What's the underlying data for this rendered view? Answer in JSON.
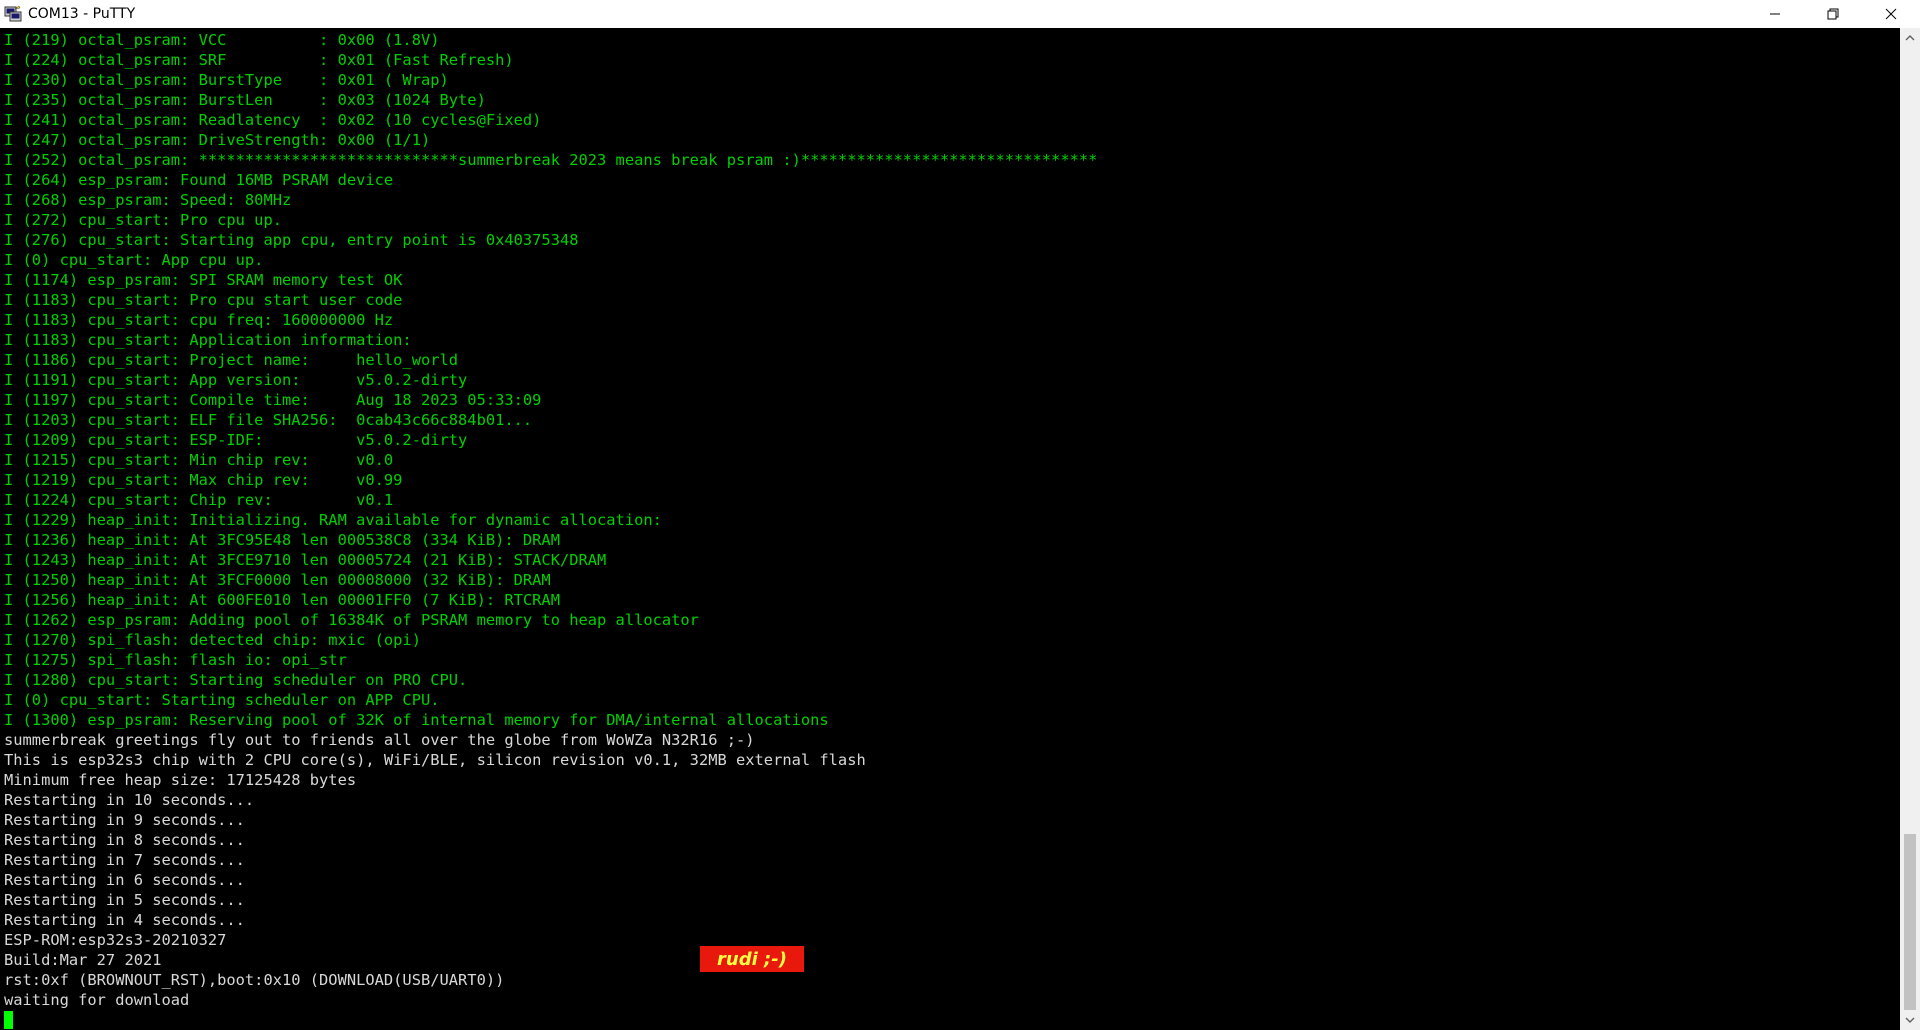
{
  "window": {
    "title": "COM13 - PuTTY",
    "icon": "putty-icon"
  },
  "controls": {
    "minimize": "minimize-icon",
    "restore": "restore-icon",
    "close": "close-icon"
  },
  "colors": {
    "log_green": "#00d000",
    "console_white": "#d8d8d8",
    "cursor_green": "#00ff00",
    "badge_red": "#e8180c",
    "badge_yellow": "#ffff40"
  },
  "terminal": {
    "lines": [
      {
        "text": "I (219) octal_psram: VCC          : 0x00 (1.8V)",
        "color": "green"
      },
      {
        "text": "I (224) octal_psram: SRF          : 0x01 (Fast Refresh)",
        "color": "green"
      },
      {
        "text": "I (230) octal_psram: BurstType    : 0x01 ( Wrap)",
        "color": "green"
      },
      {
        "text": "I (235) octal_psram: BurstLen     : 0x03 (1024 Byte)",
        "color": "green"
      },
      {
        "text": "I (241) octal_psram: Readlatency  : 0x02 (10 cycles@Fixed)",
        "color": "green"
      },
      {
        "text": "I (247) octal_psram: DriveStrength: 0x00 (1/1)",
        "color": "green"
      },
      {
        "text": "I (252) octal_psram: ****************************summerbreak 2023 means break psram :)********************************",
        "color": "green"
      },
      {
        "text": "I (264) esp_psram: Found 16MB PSRAM device",
        "color": "green"
      },
      {
        "text": "I (268) esp_psram: Speed: 80MHz",
        "color": "green"
      },
      {
        "text": "I (272) cpu_start: Pro cpu up.",
        "color": "green"
      },
      {
        "text": "I (276) cpu_start: Starting app cpu, entry point is 0x40375348",
        "color": "green"
      },
      {
        "text": "I (0) cpu_start: App cpu up.",
        "color": "green"
      },
      {
        "text": "I (1174) esp_psram: SPI SRAM memory test OK",
        "color": "green"
      },
      {
        "text": "I (1183) cpu_start: Pro cpu start user code",
        "color": "green"
      },
      {
        "text": "I (1183) cpu_start: cpu freq: 160000000 Hz",
        "color": "green"
      },
      {
        "text": "I (1183) cpu_start: Application information:",
        "color": "green"
      },
      {
        "text": "I (1186) cpu_start: Project name:     hello_world",
        "color": "green"
      },
      {
        "text": "I (1191) cpu_start: App version:      v5.0.2-dirty",
        "color": "green"
      },
      {
        "text": "I (1197) cpu_start: Compile time:     Aug 18 2023 05:33:09",
        "color": "green"
      },
      {
        "text": "I (1203) cpu_start: ELF file SHA256:  0cab43c66c884b01...",
        "color": "green"
      },
      {
        "text": "I (1209) cpu_start: ESP-IDF:          v5.0.2-dirty",
        "color": "green"
      },
      {
        "text": "I (1215) cpu_start: Min chip rev:     v0.0",
        "color": "green"
      },
      {
        "text": "I (1219) cpu_start: Max chip rev:     v0.99",
        "color": "green"
      },
      {
        "text": "I (1224) cpu_start: Chip rev:         v0.1",
        "color": "green"
      },
      {
        "text": "I (1229) heap_init: Initializing. RAM available for dynamic allocation:",
        "color": "green"
      },
      {
        "text": "I (1236) heap_init: At 3FC95E48 len 000538C8 (334 KiB): DRAM",
        "color": "green"
      },
      {
        "text": "I (1243) heap_init: At 3FCE9710 len 00005724 (21 KiB): STACK/DRAM",
        "color": "green"
      },
      {
        "text": "I (1250) heap_init: At 3FCF0000 len 00008000 (32 KiB): DRAM",
        "color": "green"
      },
      {
        "text": "I (1256) heap_init: At 600FE010 len 00001FF0 (7 KiB): RTCRAM",
        "color": "green"
      },
      {
        "text": "I (1262) esp_psram: Adding pool of 16384K of PSRAM memory to heap allocator",
        "color": "green"
      },
      {
        "text": "I (1270) spi_flash: detected chip: mxic (opi)",
        "color": "green"
      },
      {
        "text": "I (1275) spi_flash: flash io: opi_str",
        "color": "green"
      },
      {
        "text": "I (1280) cpu_start: Starting scheduler on PRO CPU.",
        "color": "green"
      },
      {
        "text": "I (0) cpu_start: Starting scheduler on APP CPU.",
        "color": "green"
      },
      {
        "text": "I (1300) esp_psram: Reserving pool of 32K of internal memory for DMA/internal allocations",
        "color": "green"
      },
      {
        "text": "summerbreak greetings fly out to friends all over the globe from WoWZa N32R16 ;-)",
        "color": "white"
      },
      {
        "text": "This is esp32s3 chip with 2 CPU core(s), WiFi/BLE, silicon revision v0.1, 32MB external flash",
        "color": "white"
      },
      {
        "text": "Minimum free heap size: 17125428 bytes",
        "color": "white"
      },
      {
        "text": "Restarting in 10 seconds...",
        "color": "white"
      },
      {
        "text": "Restarting in 9 seconds...",
        "color": "white"
      },
      {
        "text": "Restarting in 8 seconds...",
        "color": "white"
      },
      {
        "text": "Restarting in 7 seconds...",
        "color": "white"
      },
      {
        "text": "Restarting in 6 seconds...",
        "color": "white"
      },
      {
        "text": "Restarting in 5 seconds...",
        "color": "white"
      },
      {
        "text": "Restarting in 4 seconds...",
        "color": "white"
      },
      {
        "text": "ESP-ROM:esp32s3-20210327",
        "color": "white"
      },
      {
        "text": "Build:Mar 27 2021",
        "color": "white"
      },
      {
        "text": "rst:0xf (BROWNOUT_RST),boot:0x10 (DOWNLOAD(USB/UART0))",
        "color": "white"
      },
      {
        "text": "waiting for download",
        "color": "white"
      }
    ]
  },
  "watermark": {
    "text": "rudi ;-)"
  },
  "scrollbar": {
    "up_icon": "scroll-up-arrow-icon",
    "down_icon": "scroll-down-arrow-icon"
  }
}
